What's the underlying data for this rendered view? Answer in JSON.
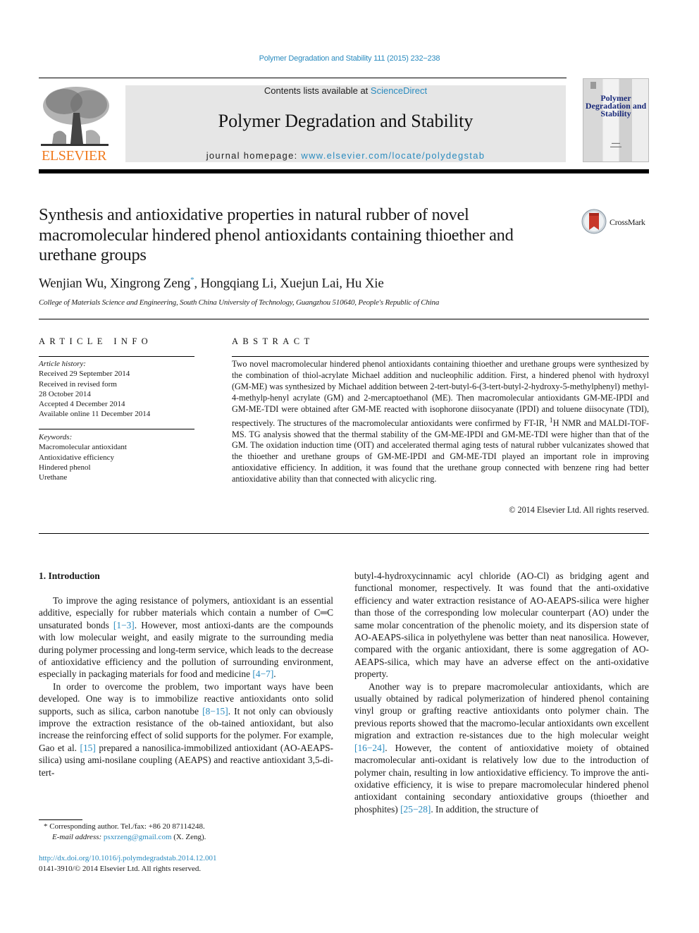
{
  "running_header": "Polymer Degradation and Stability 111 (2015) 232−238",
  "masthead": {
    "publisher_logo_text": "ELSEVIER",
    "contents_prefix": "Contents lists available at ",
    "contents_link": "ScienceDirect",
    "journal_name": "Polymer Degradation and Stability",
    "homepage_prefix": "journal homepage: ",
    "homepage_link": "www.elsevier.com/locate/polydegstab",
    "cover_title": "Polymer Degradation and Stability"
  },
  "article": {
    "title": "Synthesis and antioxidative properties in natural rubber of novel macromolecular hindered phenol antioxidants containing thioether and urethane groups",
    "crossmark_label": "CrossMark",
    "authors": [
      {
        "name": "Wenjian Wu",
        "mark": ""
      },
      {
        "name": "Xingrong Zeng",
        "mark": "*"
      },
      {
        "name": "Hongqiang Li",
        "mark": ""
      },
      {
        "name": "Xuejun Lai",
        "mark": ""
      },
      {
        "name": "Hu Xie",
        "mark": ""
      }
    ],
    "affiliation": "College of Materials Science and Engineering, South China University of Technology, Guangzhou 510640, People's Republic of China"
  },
  "article_info": {
    "heading": "ARTICLE INFO",
    "history_label": "Article history:",
    "history": [
      "Received 29 September 2014",
      "Received in revised form",
      "28 October 2014",
      "Accepted 4 December 2014",
      "Available online 11 December 2014"
    ],
    "keywords_label": "Keywords:",
    "keywords": [
      "Macromolecular antioxidant",
      "Antioxidative efficiency",
      "Hindered phenol",
      "Urethane"
    ]
  },
  "abstract": {
    "heading": "ABSTRACT",
    "text_part1": "Two novel macromolecular hindered phenol antioxidants containing thioether and urethane groups were synthesized by the combination of thiol-acrylate Michael addition and nucleophilic addition. First, a hindered phenol with hydroxyl (GM-ME) was synthesized by Michael addition between 2-tert-butyl-6-(3-tert-butyl-2-hydroxy-5-methylphenyl) methyl-4-methylp-henyl acrylate (GM) and 2-mercaptoethanol (ME). Then macromolecular antioxidants GM-ME-IPDI and GM-ME-TDI were obtained after GM-ME reacted with isophorone diisocyanate (IPDI) and toluene diisocynate (TDI), respectively. The structures of the macromolecular antioxidants were confirmed by FT-IR, ",
    "superscript": "1",
    "text_part2": "H NMR and MALDI-TOF-MS. TG analysis showed that the thermal stability of the GM-ME-IPDI and GM-ME-TDI were higher than that of the GM. The oxidation induction time (OIT) and accelerated thermal aging tests of natural rubber vulcanizates showed that the thioether and urethane groups of GM-ME-IPDI and GM-ME-TDI played an important role in improving antioxidative efficiency. In addition, it was found that the urethane group connected with benzene ring had better antioxidative ability than that connected with alicyclic ring.",
    "copyright": "© 2014 Elsevier Ltd. All rights reserved."
  },
  "body": {
    "section_heading": "1.  Introduction",
    "left_paragraphs": [
      {
        "segments": [
          {
            "t": "To improve the aging resistance of polymers, antioxidant is an essential additive, especially for rubber materials which contain a number of C═C unsaturated bonds "
          },
          {
            "t": "[1−3]",
            "ref": true
          },
          {
            "t": ". However, most antioxi-dants are the compounds with low molecular weight, and easily migrate to the surrounding media during polymer processing and long-term service, which leads to the decrease of antioxidative efficiency and the pollution of surrounding environment, especially in packaging materials for food and medicine "
          },
          {
            "t": "[4−7]",
            "ref": true
          },
          {
            "t": "."
          }
        ]
      },
      {
        "segments": [
          {
            "t": "In order to overcome the problem, two important ways have been developed. One way is to immobilize reactive antioxidants onto solid supports, such as silica, carbon nanotube "
          },
          {
            "t": "[8−15]",
            "ref": true
          },
          {
            "t": ". It not only can obviously improve the extraction resistance of the ob-tained antioxidant, but also increase the reinforcing effect of solid supports for the polymer. For example, Gao et al. "
          },
          {
            "t": "[15]",
            "ref": true
          },
          {
            "t": " prepared a nanosilica-immobilized antioxidant (AO-AEAPS-silica) using ami-nosilane coupling (AEAPS) and reactive antioxidant 3,5-di-tert-"
          }
        ]
      }
    ],
    "right_paragraphs": [
      {
        "continued": true,
        "segments": [
          {
            "t": "butyl-4-hydroxycinnamic acyl chloride (AO-Cl) as bridging agent and functional monomer, respectively. It was found that the anti-oxidative efficiency and water extraction resistance of AO-AEAPS-silica were higher than those of the corresponding low molecular counterpart (AO) under the same molar concentration of the phenolic moiety, and its dispersion state of AO-AEAPS-silica in polyethylene was better than neat nanosilica. However, compared with the organic antioxidant, there is some aggregation of AO-AEAPS-silica, which may have an adverse effect on the anti-oxidative property."
          }
        ]
      },
      {
        "segments": [
          {
            "t": "Another way is to prepare macromolecular antioxidants, which are usually obtained by radical polymerization of hindered phenol containing vinyl group or grafting reactive antioxidants onto polymer chain. The previous reports showed that the macromo-lecular antioxidants own excellent migration and extraction re-sistances due to the high molecular weight "
          },
          {
            "t": "[16−24]",
            "ref": true
          },
          {
            "t": ". However, the content of antioxidative moiety of obtained macromolecular anti-oxidant is relatively low due to the introduction of polymer chain, resulting in low antioxidative efficiency. To improve the anti-oxidative efficiency, it is wise to prepare macromolecular hindered phenol antioxidant containing secondary antioxidative groups (thioether and phosphites) "
          },
          {
            "t": "[25−28]",
            "ref": true
          },
          {
            "t": ". In addition, the structure of"
          }
        ]
      }
    ]
  },
  "footnotes": {
    "corresponding": "*  Corresponding author. Tel./fax: +86 20 87114248.",
    "email_label": "E-mail address: ",
    "email": "psxrzeng@gmail.com",
    "email_suffix": " (X. Zeng).",
    "doi": "http://dx.doi.org/10.1016/j.polymdegradstab.2014.12.001",
    "issn_line": "0141-3910/© 2014 Elsevier Ltd. All rights reserved."
  },
  "colors": {
    "link": "#2a8bbf",
    "publisher_orange": "#f07a1e",
    "masthead_gray": "#e6e6e6",
    "crossmark_red": "#c8382a"
  }
}
